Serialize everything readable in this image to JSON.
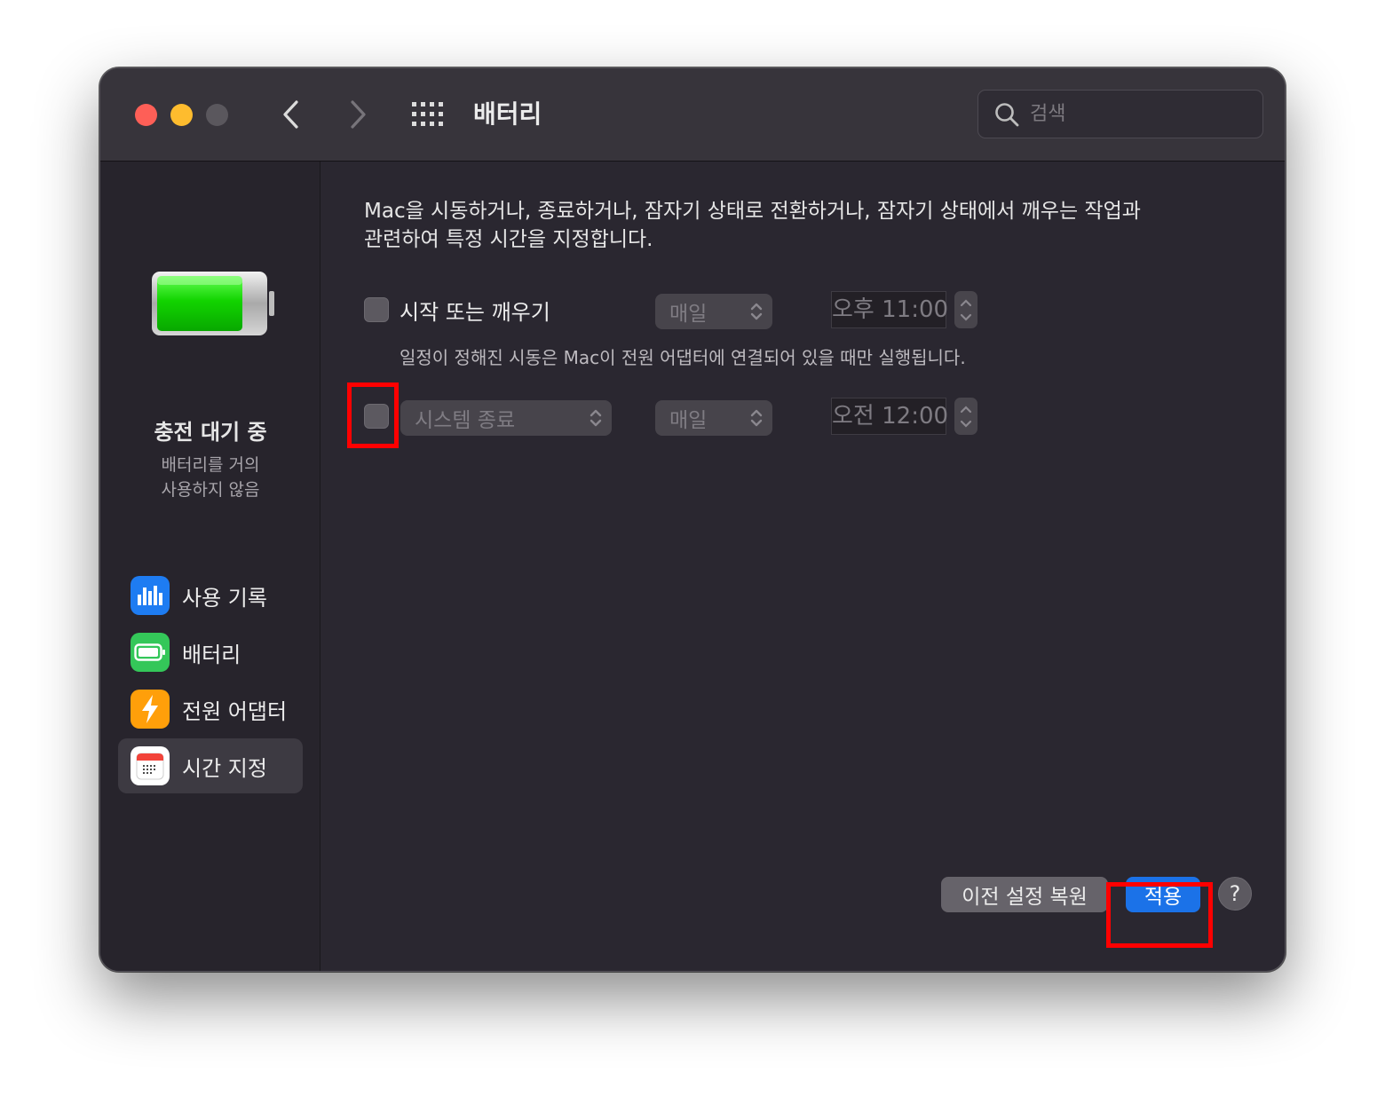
{
  "window": {
    "title": "배터리",
    "search": {
      "placeholder": "검색"
    }
  },
  "sidebar": {
    "status_title": "충전 대기 중",
    "status_line1": "배터리를 거의",
    "status_line2": "사용하지 않음",
    "items": [
      {
        "label": "사용 기록",
        "icon": "bar-chart-icon",
        "color": "#1e7cf2"
      },
      {
        "label": "배터리",
        "icon": "battery-icon",
        "color": "#34c759"
      },
      {
        "label": "전원 어댑터",
        "icon": "lightning-icon",
        "color": "#ff9f0a"
      },
      {
        "label": "시간 지정",
        "icon": "calendar-icon",
        "color": "#ffffff",
        "selected": true
      }
    ]
  },
  "schedule": {
    "description_line1": "Mac을 시동하거나, 종료하거나, 잠자기 상태로 전환하거나, 잠자기 상태에서 깨우는 작업과",
    "description_line2": "관련하여 특정 시간을 지정합니다.",
    "startup": {
      "label": "시작 또는 깨우기",
      "frequency": "매일",
      "time": "오후 11:00",
      "checked": false
    },
    "note": "일정이 정해진 시동은 Mac이 전원 어댑터에 연결되어 있을 때만 실행됩니다.",
    "shutdown": {
      "action": "시스템 종료",
      "frequency": "매일",
      "time": "오전 12:00",
      "checked": false
    }
  },
  "footer": {
    "restore_label": "이전 설정 복원",
    "apply_label": "적용",
    "help_label": "?"
  },
  "colors": {
    "highlight": "#ff0000",
    "apply": "#1b72e8"
  }
}
